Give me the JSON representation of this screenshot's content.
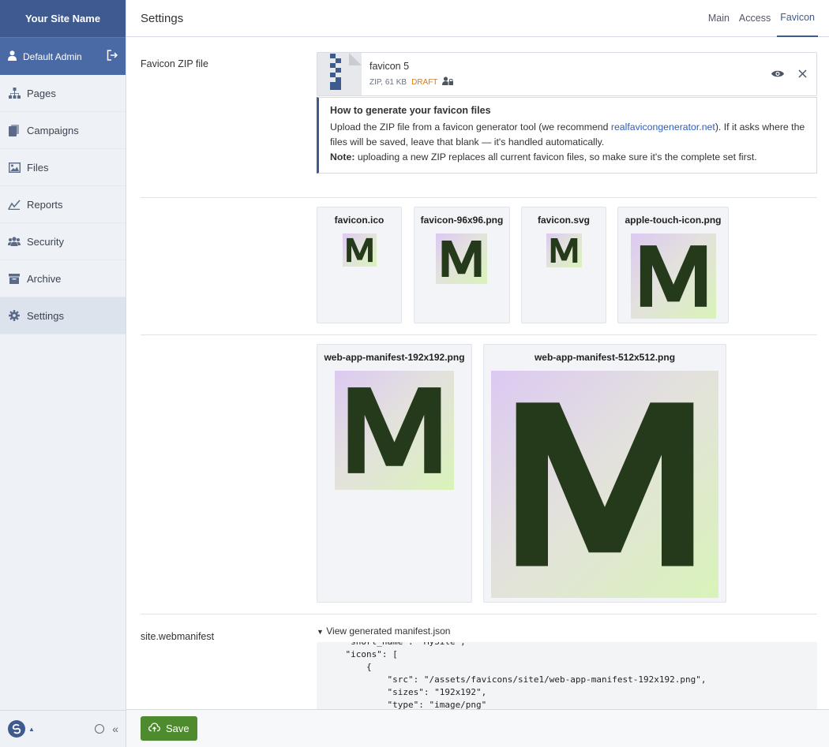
{
  "sidebar": {
    "site_name": "Your Site Name",
    "user_name": "Default Admin",
    "items": [
      {
        "label": "Pages",
        "icon": "sitemap-icon"
      },
      {
        "label": "Campaigns",
        "icon": "documents-icon"
      },
      {
        "label": "Files",
        "icon": "image-icon"
      },
      {
        "label": "Reports",
        "icon": "chart-line-icon"
      },
      {
        "label": "Security",
        "icon": "users-icon"
      },
      {
        "label": "Archive",
        "icon": "archive-icon"
      },
      {
        "label": "Settings",
        "icon": "gear-icon",
        "active": true
      }
    ],
    "collapse_label": "«"
  },
  "header": {
    "title": "Settings",
    "tabs": [
      {
        "label": "Main"
      },
      {
        "label": "Access"
      },
      {
        "label": "Favicon",
        "active": true
      }
    ]
  },
  "favicon_zip": {
    "row_label": "Favicon ZIP file",
    "file_name": "favicon 5",
    "file_meta": "ZIP, 61 KB",
    "status": "DRAFT",
    "help_title": "How to generate your favicon files",
    "help_text_1": "Upload the ZIP file from a favicon generator tool (we recommend ",
    "help_link": "realfavicongenerator.net",
    "help_text_2": "). If it asks where the files will be saved, leave that blank — it's handled automatically.",
    "note_label": "Note:",
    "note_text": " uploading a new ZIP replaces all current favicon files, so make sure it's the complete set first."
  },
  "icons_row1": [
    {
      "label": "favicon.ico"
    },
    {
      "label": "favicon-96x96.png"
    },
    {
      "label": "favicon.svg"
    },
    {
      "label": "apple-touch-icon.png"
    }
  ],
  "icons_row2": [
    {
      "label": "web-app-manifest-192x192.png"
    },
    {
      "label": "web-app-manifest-512x512.png"
    }
  ],
  "manifest": {
    "row_label": "site.webmanifest",
    "summary": "View generated manifest.json",
    "code": "    \"short_name\": \"MySite\",\n    \"icons\": [\n        {\n            \"src\": \"/assets/favicons/site1/web-app-manifest-192x192.png\",\n            \"sizes\": \"192x192\",\n            \"type\": \"image/png\""
  },
  "footer": {
    "save_label": "Save"
  },
  "colors": {
    "brand": "#3f5a8e",
    "save": "#4e8b2f",
    "draft": "#d97a1a",
    "link": "#2f5db8"
  }
}
